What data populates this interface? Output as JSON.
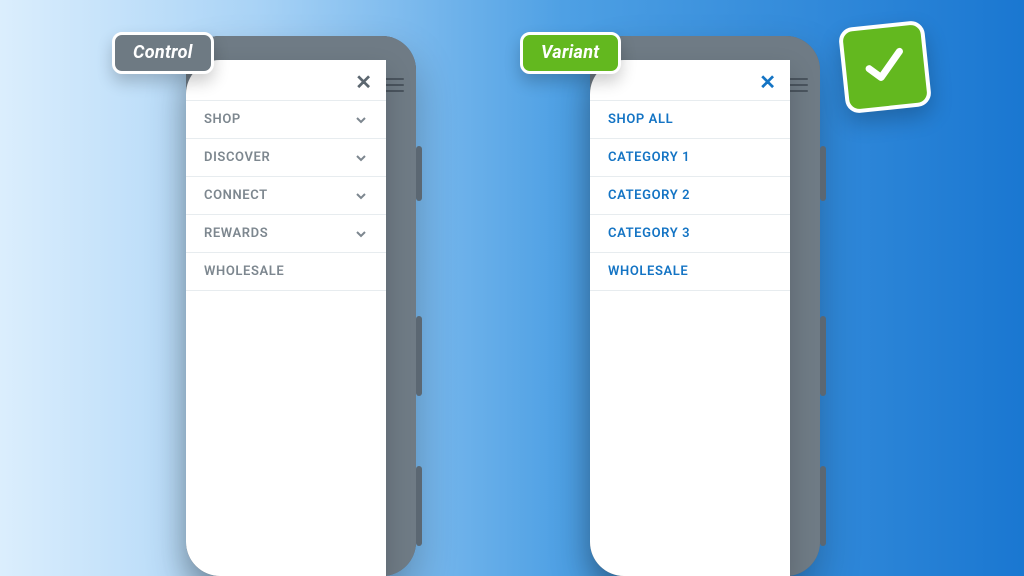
{
  "control": {
    "tag_label": "Control",
    "items": [
      {
        "label": "SHOP",
        "expandable": true
      },
      {
        "label": "DISCOVER",
        "expandable": true
      },
      {
        "label": "CONNECT",
        "expandable": true
      },
      {
        "label": "REWARDS",
        "expandable": true
      },
      {
        "label": "WHOLESALE",
        "expandable": false
      }
    ]
  },
  "variant": {
    "tag_label": "Variant",
    "items": [
      {
        "label": "SHOP ALL"
      },
      {
        "label": "CATEGORY 1"
      },
      {
        "label": "CATEGORY 2"
      },
      {
        "label": "CATEGORY 3"
      },
      {
        "label": "WHOLESALE"
      }
    ]
  },
  "colors": {
    "variant_accent": "#1474c4",
    "control_text": "#7d878f",
    "tag_control": "#6e7a83",
    "tag_variant": "#63b81f"
  }
}
